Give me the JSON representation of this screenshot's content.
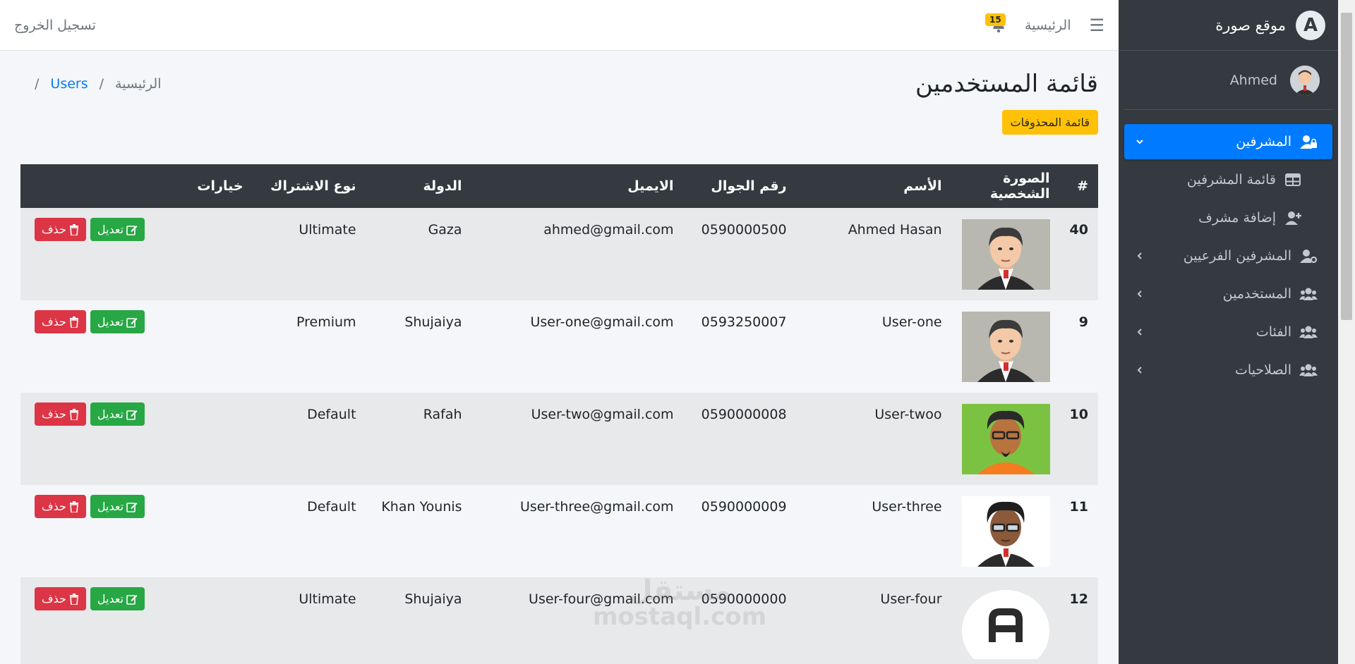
{
  "navbar": {
    "home_label": "الرئيسية",
    "notification_count": "15",
    "logout_label": "تسجيل الخروج"
  },
  "sidebar": {
    "brand": "موقع صورة",
    "user_name": "Ahmed",
    "items": [
      {
        "label": "المشرفين",
        "active": true
      },
      {
        "label": "قائمة المشرفين"
      },
      {
        "label": "إضافة مشرف"
      },
      {
        "label": "المشرفين الفرعيين"
      },
      {
        "label": "المستخدمين"
      },
      {
        "label": "الفئات"
      },
      {
        "label": "الصلاحيات"
      }
    ]
  },
  "page": {
    "title": "قائمة المستخدمين",
    "breadcrumb": [
      "الرئيسية",
      "/",
      "Users",
      "/"
    ],
    "deleted_list_button": "قائمة المحذوفات"
  },
  "table": {
    "headers": [
      "#",
      "الصورة الشخصية",
      "الأسم",
      "رقم الجوال",
      "الايميل",
      "الدولة",
      "نوع الاشتراك",
      "خيارات"
    ],
    "rows": [
      {
        "id": "40",
        "name": "Ahmed Hasan",
        "phone": "0590000500",
        "email": "ahmed@gmail.com",
        "country": "Gaza",
        "plan": "Ultimate",
        "photo": "avatar-suit"
      },
      {
        "id": "9",
        "name": "User-one",
        "phone": "0593250007",
        "email": "User-one@gmail.com",
        "country": "Shujaiya",
        "plan": "Premium",
        "photo": "avatar-suit"
      },
      {
        "id": "10",
        "name": "User-twoo",
        "phone": "0590000008",
        "email": "User-two@gmail.com",
        "country": "Rafah",
        "plan": "Default",
        "photo": "avatar-green"
      },
      {
        "id": "11",
        "name": "User-three",
        "phone": "0590000009",
        "email": "User-three@gmail.com",
        "country": "Khan Younis",
        "plan": "Default",
        "photo": "avatar-curly"
      },
      {
        "id": "12",
        "name": "User-four",
        "phone": "0590000000",
        "email": "User-four@gmail.com",
        "country": "Shujaiya",
        "plan": "Ultimate",
        "photo": "logo-a"
      }
    ],
    "edit_label": "تعديل",
    "delete_label": "حذف"
  },
  "watermark": {
    "brand": "مستقل",
    "url": "mostaql.com"
  },
  "colors": {
    "primary": "#007bff",
    "success": "#28a745",
    "danger": "#dc3545",
    "warning": "#ffc107",
    "sidebar": "#343a40"
  }
}
